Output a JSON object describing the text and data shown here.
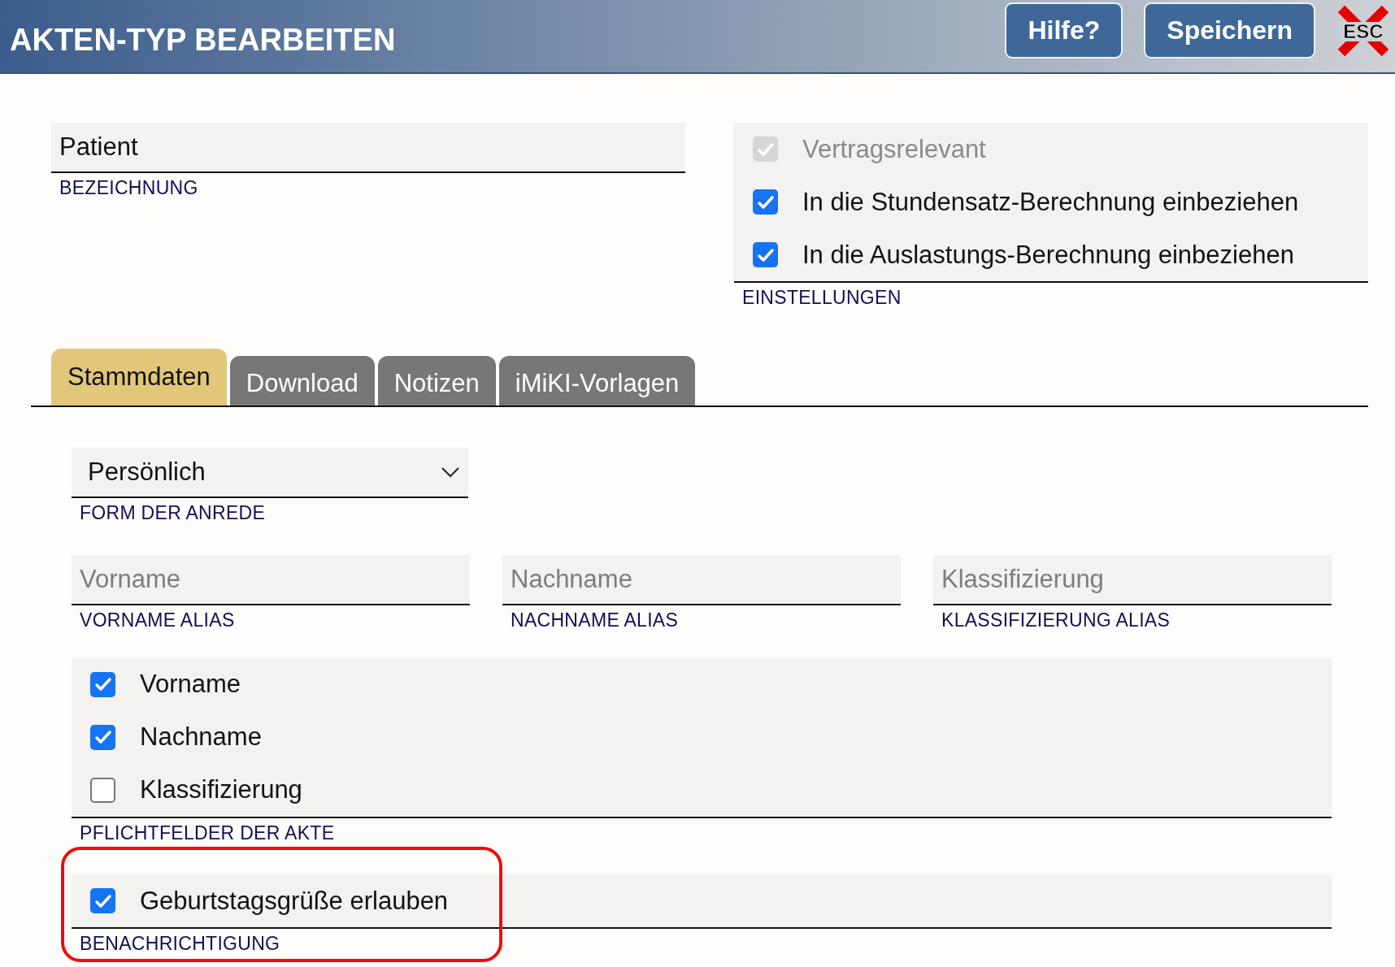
{
  "header": {
    "title": "AKTEN-TYP BEARBEITEN",
    "buttons": [
      "Hilfe?",
      "Speichern"
    ],
    "close_label": "ESC"
  },
  "bezeichnung": {
    "value": "Patient",
    "label": "BEZEICHNUNG"
  },
  "einstellungen": {
    "label": "EINSTELLUNGEN",
    "options": [
      {
        "label": "Vertragsrelevant",
        "checked": true,
        "disabled": true
      },
      {
        "label": "In die Stundensatz-Berechnung einbeziehen",
        "checked": true,
        "disabled": false
      },
      {
        "label": "In die Auslastungs-Berechnung einbeziehen",
        "checked": true,
        "disabled": false
      }
    ]
  },
  "tabs": [
    {
      "label": "Stammdaten",
      "selected": true
    },
    {
      "label": "Download",
      "selected": false
    },
    {
      "label": "Notizen",
      "selected": false
    },
    {
      "label": "iMiKI-Vorlagen",
      "selected": false
    }
  ],
  "anrede": {
    "value": "Persönlich",
    "label": "FORM DER ANREDE"
  },
  "aliases": [
    {
      "placeholder": "Vorname",
      "label": "VORNAME ALIAS"
    },
    {
      "placeholder": "Nachname",
      "label": "NACHNAME ALIAS"
    },
    {
      "placeholder": "Klassifizierung",
      "label": "KLASSIFIZIERUNG ALIAS"
    }
  ],
  "pflichtfelder": {
    "label": "PFLICHTFELDER DER AKTE",
    "options": [
      {
        "label": "Vorname",
        "checked": true,
        "disabled": false
      },
      {
        "label": "Nachname",
        "checked": true,
        "disabled": false
      },
      {
        "label": "Klassifizierung",
        "checked": false,
        "disabled": false
      }
    ]
  },
  "benachrichtigung": {
    "label": "BENACHRICHTIGUNG",
    "highlighted": true,
    "options": [
      {
        "label": "Geburtstagsgrüße erlauben",
        "checked": true,
        "disabled": false
      }
    ]
  }
}
